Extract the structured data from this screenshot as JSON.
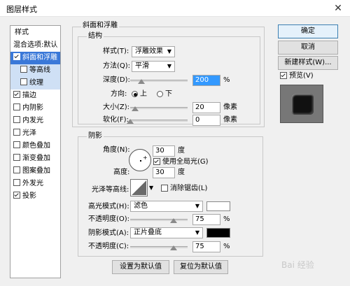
{
  "window": {
    "title": "图层样式",
    "close_glyph": "✕"
  },
  "left_panel": {
    "header": "样式",
    "items": [
      {
        "label": "混合选项:默认",
        "checkbox": false,
        "checked": false,
        "state": "normal"
      },
      {
        "label": "斜面和浮雕",
        "checkbox": true,
        "checked": true,
        "state": "selected"
      },
      {
        "label": "等高线",
        "checkbox": true,
        "checked": false,
        "state": "sub"
      },
      {
        "label": "纹理",
        "checkbox": true,
        "checked": false,
        "state": "sub"
      },
      {
        "label": "描边",
        "checkbox": true,
        "checked": true,
        "state": "normal"
      },
      {
        "label": "内阴影",
        "checkbox": true,
        "checked": false,
        "state": "normal"
      },
      {
        "label": "内发光",
        "checkbox": true,
        "checked": false,
        "state": "normal"
      },
      {
        "label": "光泽",
        "checkbox": true,
        "checked": false,
        "state": "normal"
      },
      {
        "label": "颜色叠加",
        "checkbox": true,
        "checked": false,
        "state": "normal"
      },
      {
        "label": "渐变叠加",
        "checkbox": true,
        "checked": false,
        "state": "normal"
      },
      {
        "label": "图案叠加",
        "checkbox": true,
        "checked": false,
        "state": "normal"
      },
      {
        "label": "外发光",
        "checkbox": true,
        "checked": false,
        "state": "normal"
      },
      {
        "label": "投影",
        "checkbox": true,
        "checked": true,
        "state": "normal"
      }
    ]
  },
  "bevel": {
    "group_title": "斜面和浮雕",
    "structure_title": "结构",
    "style_label": "样式(T):",
    "style_value": "浮雕效果",
    "method_label": "方法(Q):",
    "method_value": "平滑",
    "depth_label": "深度(D):",
    "depth_value": "200",
    "depth_unit": "%",
    "depth_fraction": 0.2,
    "direction_label": "方向:",
    "dir_up": "上",
    "dir_down": "下",
    "direction_selected": "上",
    "size_label": "大小(Z):",
    "size_value": "20",
    "size_unit": "像素",
    "size_fraction": 0.08,
    "soften_label": "软化(F):",
    "soften_value": "0",
    "soften_unit": "像素",
    "soften_fraction": 0.0
  },
  "shading": {
    "title": "阴影",
    "angle_label": "角度(N):",
    "angle_value": "30",
    "angle_unit": "度",
    "global_light_label": "使用全局光(G)",
    "global_light_checked": true,
    "altitude_label": "高度:",
    "altitude_value": "30",
    "altitude_unit": "度",
    "gloss_label": "光泽等高线:",
    "antialias_label": "消除锯齿(L)",
    "antialias_checked": false,
    "highlight_mode_label": "高光模式(H):",
    "highlight_mode_value": "滤色",
    "highlight_color": "#ffffff",
    "highlight_opacity_label": "不透明度(O):",
    "highlight_opacity_value": "75",
    "highlight_opacity_unit": "%",
    "highlight_opacity_fraction": 0.75,
    "shadow_mode_label": "阴影模式(A):",
    "shadow_mode_value": "正片叠底",
    "shadow_color": "#000000",
    "shadow_opacity_label": "不透明度(C):",
    "shadow_opacity_value": "75",
    "shadow_opacity_unit": "%",
    "shadow_opacity_fraction": 0.75
  },
  "buttons": {
    "set_default": "设置为默认值",
    "reset_default": "复位为默认值",
    "ok": "确定",
    "reset": "取消",
    "new_style": "新建样式(W)...",
    "preview_label": "预览(V)",
    "preview_checked": true
  },
  "watermark": "Bai 经验"
}
